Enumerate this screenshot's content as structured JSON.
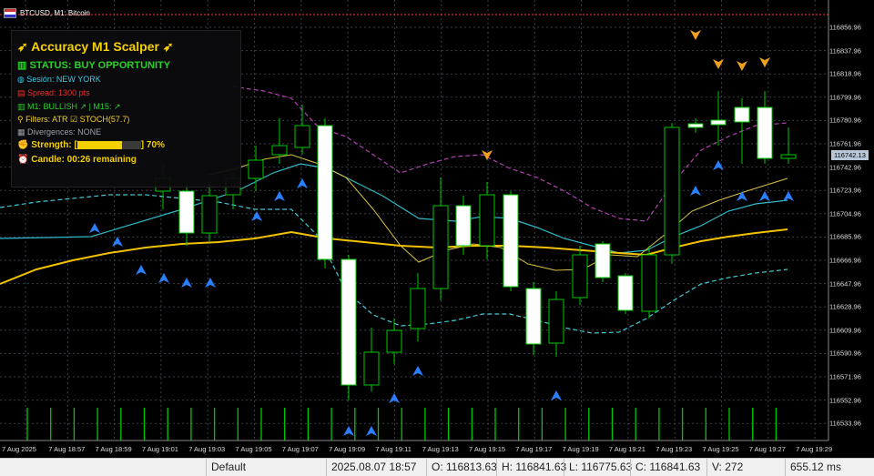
{
  "window": {
    "symbol_title": "BTCUSD, M1: Bitcoin"
  },
  "panel": {
    "title": "Accuracy M1 Scalper",
    "status": "STATUS: BUY OPPORTUNITY",
    "session": "Sesión: NEW YORK",
    "spread": "Spread: 1300 pts",
    "trend": "M1: BULLISH ↗ | M15: ↗",
    "filters": "Filters: ATR",
    "filters2": "STOCH(57.7)",
    "divergences": "Divergences:",
    "divergences_value": "NONE",
    "strength_label": "Strength: [",
    "strength_value": 0.7,
    "strength_text": "70%",
    "candle": "Candle: 00:26 remaining"
  },
  "price_axis": [
    "116856.96",
    "116837.96",
    "116818.96",
    "116799.96",
    "116780.96",
    "116761.96",
    "116742.96",
    "116723.96",
    "116704.96",
    "116685.96",
    "116666.96",
    "116647.96",
    "116628.96",
    "116609.96",
    "116590.96",
    "116571.96",
    "116552.96",
    "116533.96"
  ],
  "current_price_tag": "116742.13",
  "time_axis": [
    "7 Aug 2025",
    "7 Aug 18:57",
    "7 Aug 18:59",
    "7 Aug 19:01",
    "7 Aug 19:03",
    "7 Aug 19:05",
    "7 Aug 19:07",
    "7 Aug 19:09",
    "7 Aug 19:11",
    "7 Aug 19:13",
    "7 Aug 19:15",
    "7 Aug 19:17",
    "7 Aug 19:19",
    "7 Aug 19:21",
    "7 Aug 19:23",
    "7 Aug 19:25",
    "7 Aug 19:27",
    "7 Aug 19:29"
  ],
  "status_bar": {
    "profile": "Default",
    "datetime": "2025.08.07 18:57",
    "open": "O: 116813.63",
    "high": "H: 116841.63",
    "low": "L: 116775.63",
    "close": "C: 116841.63",
    "volume": "V: 272",
    "ping": "655.12 ms"
  },
  "colors": {
    "bull_candle": "#00c800",
    "bear_body": "#ffffff",
    "ma_slow": "#f2c200",
    "ma_fast": "#d8c040",
    "band_upper": "#b040b0",
    "band_lower": "#40c8d8",
    "buy_arrow": "#2a7fff",
    "sell_arrow": "#f0a020",
    "bid_line": "#ff2a2a",
    "grid": "#3a3f4a"
  }
}
